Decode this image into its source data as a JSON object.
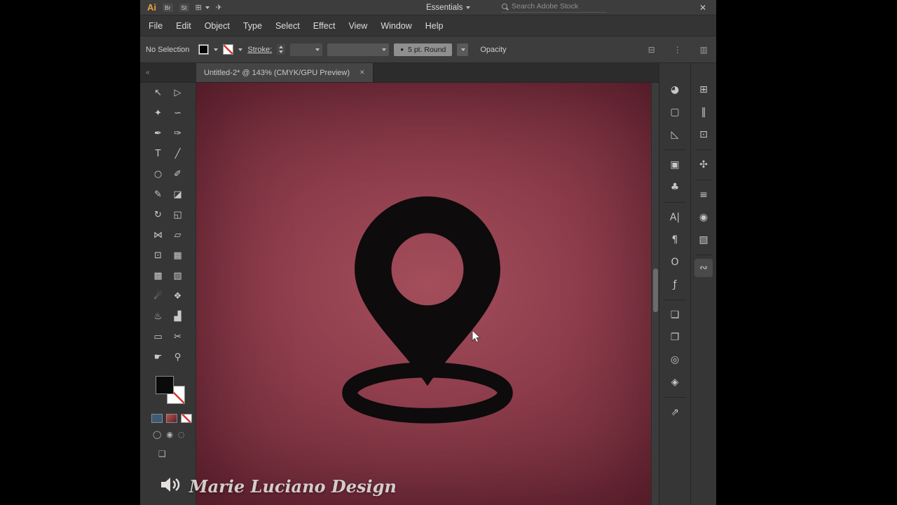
{
  "titlebar": {
    "logo": "Ai",
    "bridge_label": "Br",
    "stock_label": "St",
    "workspace_name": "Essentials",
    "search_placeholder": "Search Adobe Stock",
    "close_glyph": "✕"
  },
  "icons": {
    "layout_grid": "⊞",
    "share_plane": "✈",
    "draw_normal": "◯",
    "draw_behind": "◉",
    "draw_inside": "◌",
    "screen_mode": "❑"
  },
  "menubar": {
    "items": [
      "File",
      "Edit",
      "Object",
      "Type",
      "Select",
      "Effect",
      "View",
      "Window",
      "Help"
    ]
  },
  "control_bar": {
    "selection_status": "No Selection",
    "stroke_label": "Stroke:",
    "brush_bullet": "●",
    "brush_definition": "5 pt. Round",
    "opacity_label": "Opacity",
    "dock_icons": [
      {
        "name": "dock-grid",
        "glyph": "⊟"
      },
      {
        "name": "dock-flow",
        "glyph": "⋮"
      },
      {
        "name": "dock-columns",
        "glyph": "▥"
      }
    ]
  },
  "tools_panel": {
    "collapse_glyph": "«",
    "tools": [
      {
        "name": "selection",
        "glyph": "↖"
      },
      {
        "name": "direct-selection",
        "glyph": "▷"
      },
      {
        "name": "magic-wand",
        "glyph": "✦"
      },
      {
        "name": "lasso",
        "glyph": "∽"
      },
      {
        "name": "pen",
        "glyph": "✒"
      },
      {
        "name": "curvature",
        "glyph": "✑"
      },
      {
        "name": "type",
        "glyph": "T"
      },
      {
        "name": "line-segment",
        "glyph": "╱"
      },
      {
        "name": "ellipse",
        "glyph": "○"
      },
      {
        "name": "paintbrush",
        "glyph": "✐"
      },
      {
        "name": "pencil",
        "glyph": "✎"
      },
      {
        "name": "shaper",
        "glyph": "◪"
      },
      {
        "name": "rotate",
        "glyph": "↻"
      },
      {
        "name": "scale",
        "glyph": "◱"
      },
      {
        "name": "width",
        "glyph": "⋈"
      },
      {
        "name": "free-transform",
        "glyph": "▱"
      },
      {
        "name": "shape-builder",
        "glyph": "⊡"
      },
      {
        "name": "perspective-grid",
        "glyph": "▦"
      },
      {
        "name": "mesh",
        "glyph": "▩"
      },
      {
        "name": "gradient",
        "glyph": "▧"
      },
      {
        "name": "eyedropper",
        "glyph": "☄"
      },
      {
        "name": "blend",
        "glyph": "❖"
      },
      {
        "name": "symbol-sprayer",
        "glyph": "♨"
      },
      {
        "name": "column-graph",
        "glyph": "▟"
      },
      {
        "name": "artboard",
        "glyph": "▭"
      },
      {
        "name": "slice",
        "glyph": "✂"
      },
      {
        "name": "hand",
        "glyph": "☛"
      },
      {
        "name": "zoom",
        "glyph": "⚲"
      }
    ]
  },
  "document": {
    "tab_title": "Untitled-2* @ 143% (CMYK/GPU Preview)",
    "close_glyph": "✕"
  },
  "artboard": {
    "center_color": "#a44e5b",
    "mid_color": "#8e3d4c",
    "edge_color": "#6c2936",
    "pin_color": "#0d0b0c"
  },
  "right_panels": {
    "strip1": [
      {
        "name": "color-panel",
        "glyph": "◕"
      },
      {
        "name": "libraries-panel",
        "glyph": "▢"
      },
      {
        "name": "color-guide-panel",
        "glyph": "◺"
      },
      {
        "sep": true
      },
      {
        "name": "image-trace-panel",
        "glyph": "▣"
      },
      {
        "name": "symbols-panel",
        "glyph": "♣"
      },
      {
        "sep": true
      },
      {
        "name": "character-panel",
        "glyph": "A|"
      },
      {
        "name": "paragraph-panel",
        "glyph": "¶"
      },
      {
        "name": "opentype-panel",
        "glyph": "O"
      },
      {
        "name": "glyphs-panel",
        "glyph": "ƒ"
      },
      {
        "sep": true
      },
      {
        "name": "artboards-panel",
        "glyph": "❏"
      },
      {
        "name": "asset-export-panel",
        "glyph": "❐"
      },
      {
        "name": "appearance-panel",
        "glyph": "◎"
      },
      {
        "name": "layers-panel",
        "glyph": "◈"
      },
      {
        "sep": true
      },
      {
        "name": "export-panel",
        "glyph": "⇗"
      }
    ],
    "strip2": [
      {
        "name": "transform-panel",
        "glyph": "⊞"
      },
      {
        "name": "align-panel",
        "glyph": "‖"
      },
      {
        "name": "pathfinder-panel",
        "glyph": "⊡"
      },
      {
        "sep": true
      },
      {
        "name": "brushes-panel",
        "glyph": "✣"
      },
      {
        "sep": true
      },
      {
        "name": "stroke-panel",
        "glyph": "≡"
      },
      {
        "name": "gradient-panel",
        "glyph": "◉"
      },
      {
        "name": "transparency-panel",
        "glyph": "▧"
      },
      {
        "sep": true
      },
      {
        "name": "graphic-styles-panel",
        "glyph": "∾",
        "chip": true
      }
    ]
  },
  "watermark": {
    "text": "Marie Luciano Design"
  }
}
